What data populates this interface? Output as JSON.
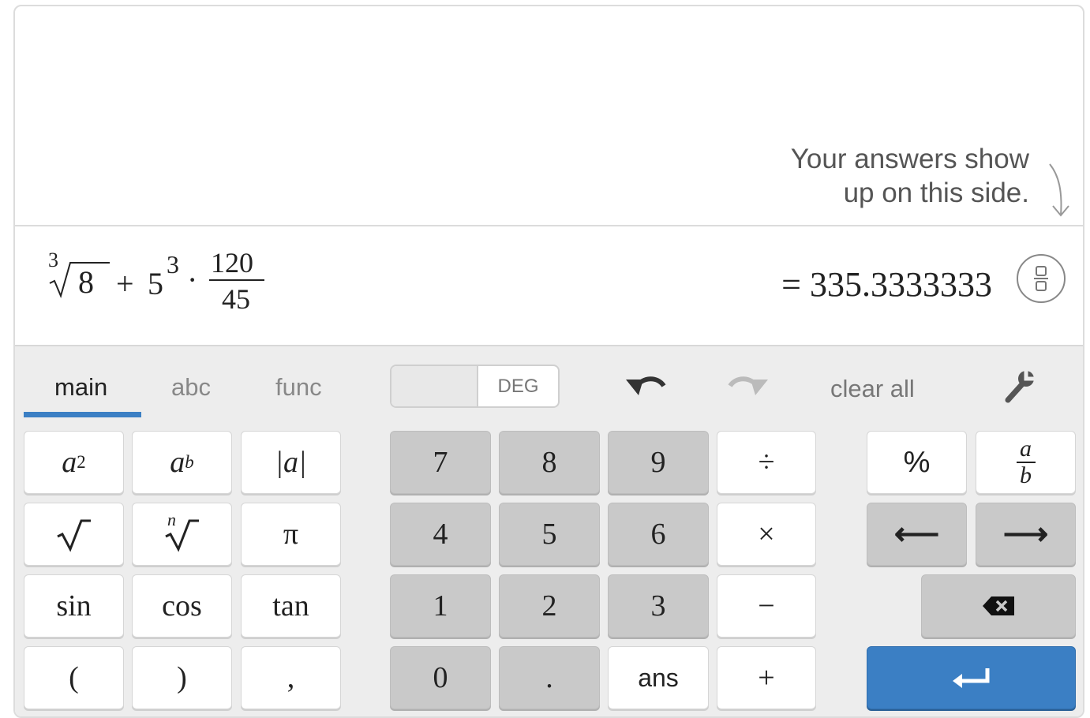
{
  "history": {
    "hint_line1": "Your answers show",
    "hint_line2": "up on this side."
  },
  "expression": {
    "root_index": "3",
    "radicand": "8",
    "plus": "+",
    "base": "5",
    "exponent": "3",
    "dot": "·",
    "numerator": "120",
    "denominator": "45"
  },
  "result": "= 335.3333333",
  "toolbar": {
    "tabs": [
      "main",
      "abc",
      "func"
    ],
    "active_tab": "main",
    "angle_mode": "DEG",
    "clear_all": "clear all"
  },
  "keys": {
    "square": {
      "base": "a",
      "exp": "2"
    },
    "power": {
      "base": "a",
      "exp": "b"
    },
    "abs": "|a|",
    "sqrt": "√",
    "nthroot_index": "n",
    "nthroot": "√",
    "pi": "π",
    "sin": "sin",
    "cos": "cos",
    "tan": "tan",
    "lparen": "(",
    "rparen": ")",
    "comma": ",",
    "d7": "7",
    "d8": "8",
    "d9": "9",
    "d4": "4",
    "d5": "5",
    "d6": "6",
    "d1": "1",
    "d2": "2",
    "d3": "3",
    "d0": "0",
    "dot": ".",
    "ans": "ans",
    "divide": "÷",
    "times": "×",
    "minus": "−",
    "plus": "+",
    "percent": "%",
    "fraction": {
      "num": "a",
      "den": "b"
    },
    "left": "⟵",
    "right": "⟶"
  },
  "colors": {
    "accent": "#3b7fc4",
    "digit_key": "#c9c9c9",
    "keypad_bg": "#ededed"
  }
}
